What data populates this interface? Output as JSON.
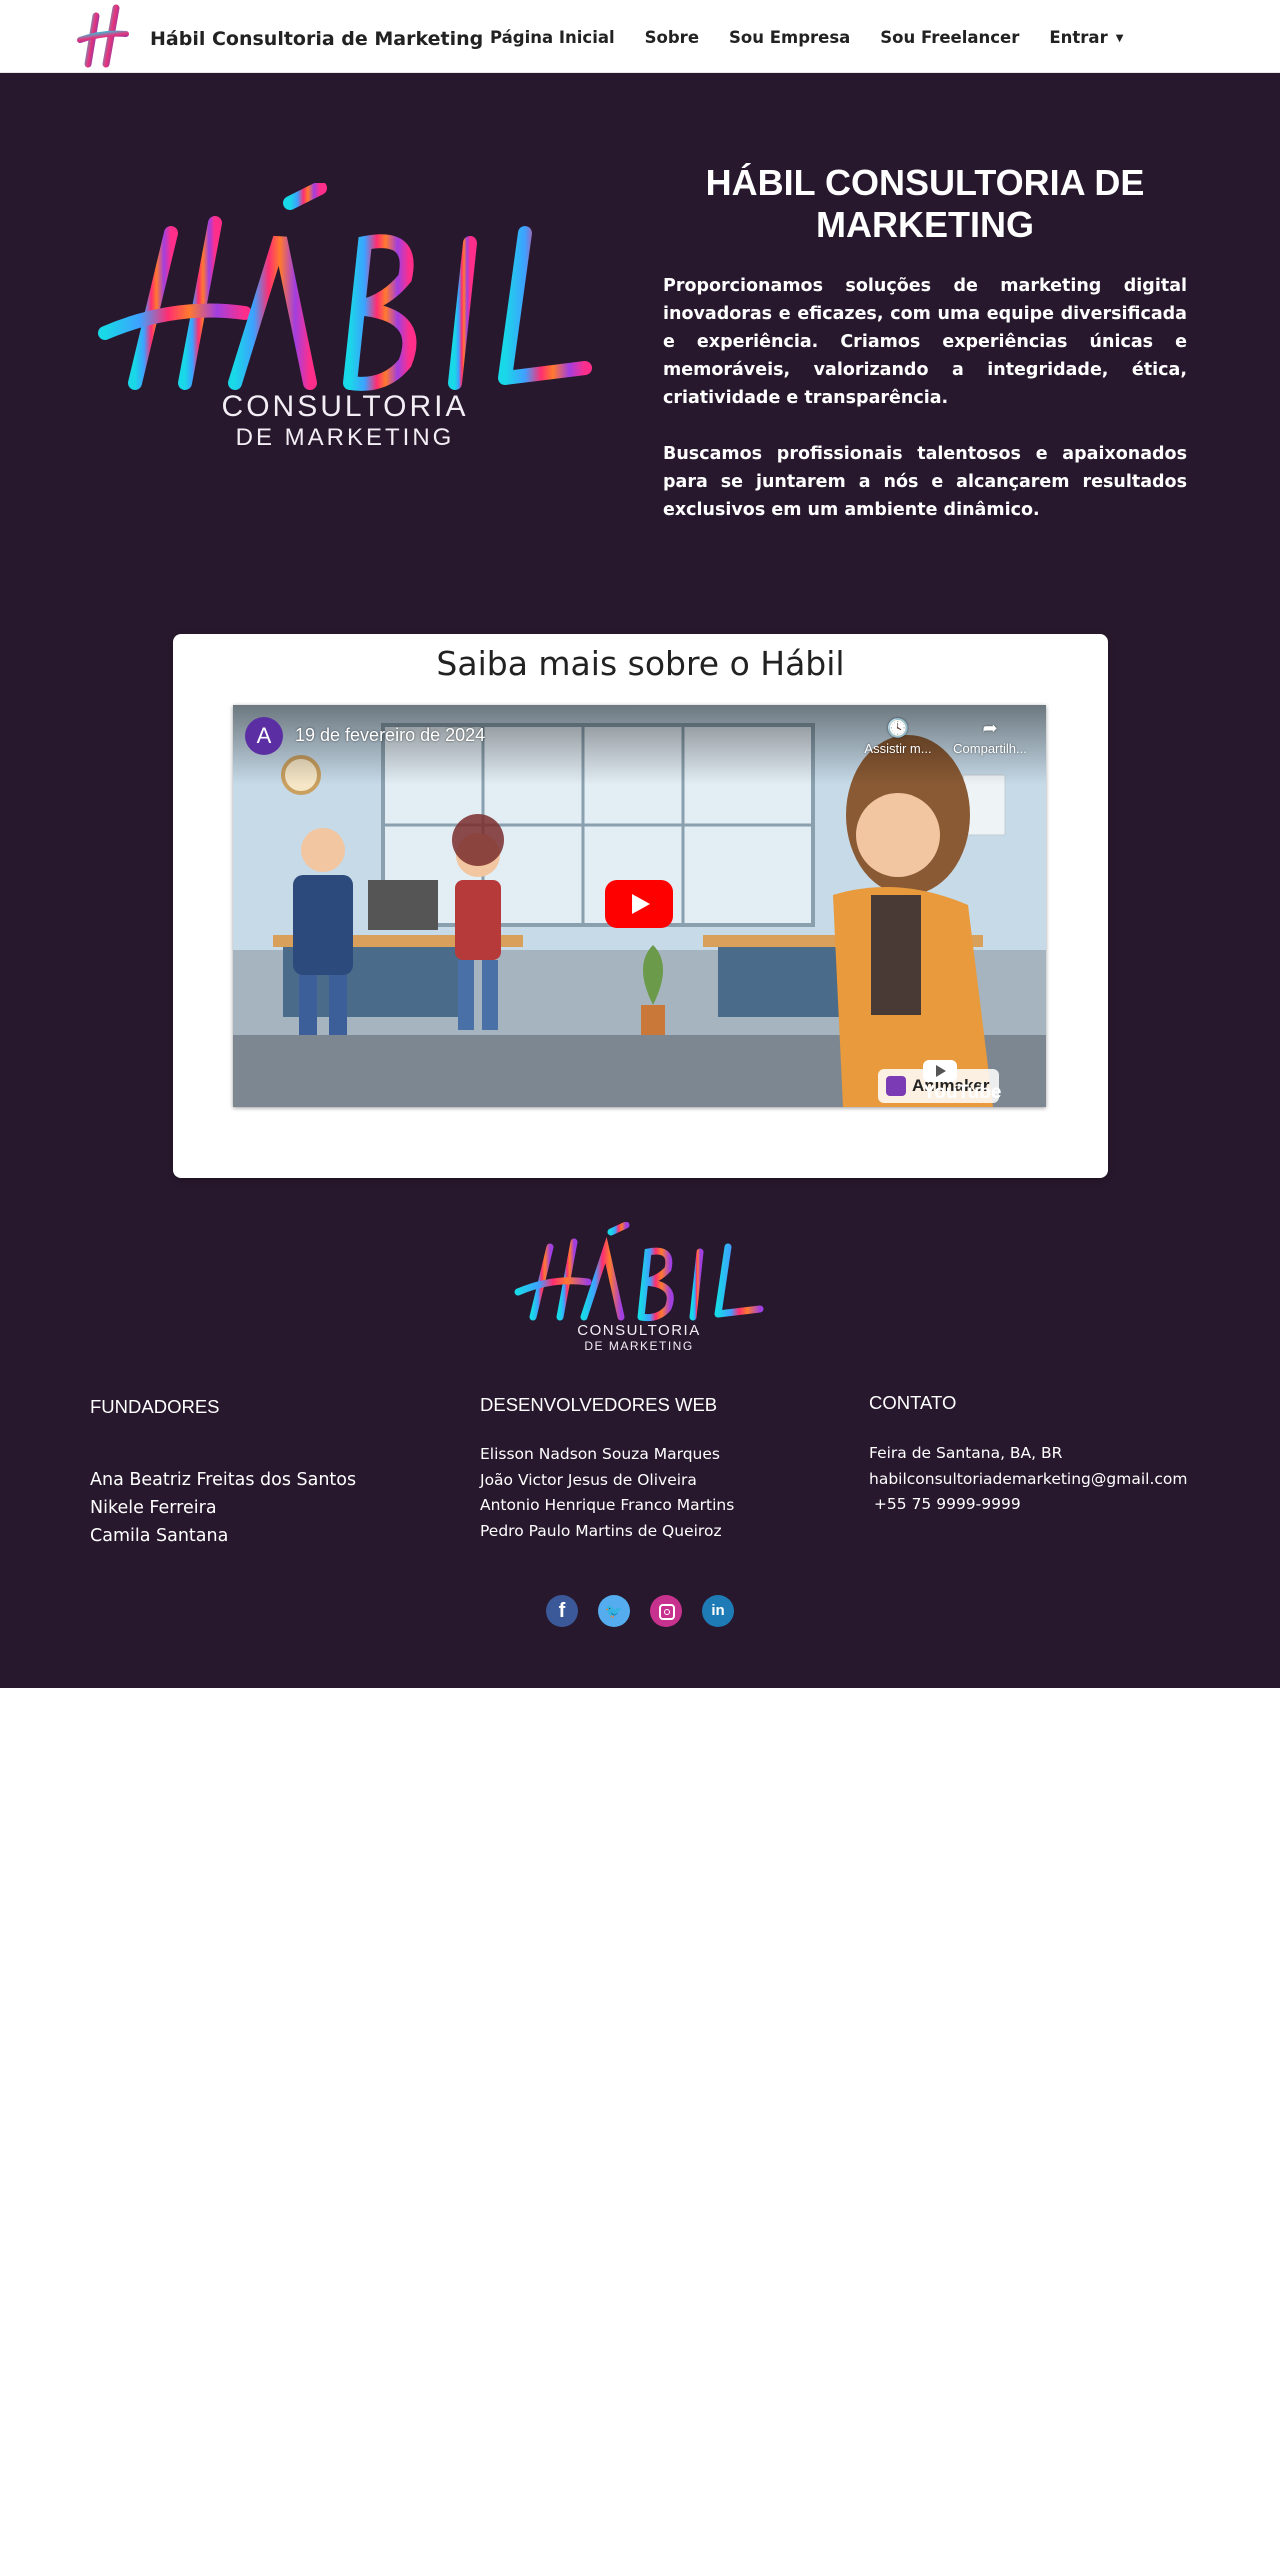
{
  "navbar": {
    "brand": "Hábil Consultoria de Marketing",
    "links": [
      "Página Inicial",
      "Sobre",
      "Sou Empresa",
      "Sou Freelancer",
      "Entrar"
    ]
  },
  "hero": {
    "logo_word": "HÁBIL",
    "logo_sub1": "CONSULTORIA",
    "logo_sub2": "DE MARKETING",
    "title": "HÁBIL CONSULTORIA DE MARKETING",
    "paragraph1": "Proporcionamos soluções de marketing digital inovadoras e eficazes, com uma equipe diversificada e experiência. Criamos experiências únicas e memoráveis, valorizando a integridade, ética, criatividade e transparência.",
    "paragraph2": "Buscamos profissionais talentosos e apaixonados para se juntarem a nós e alcançarem resultados exclusivos em um ambiente dinâmico."
  },
  "video": {
    "heading": "Saiba mais sobre o Hábil",
    "channel_initial": "A",
    "title": "19 de fevereiro de 2024",
    "watch_later": "Assistir m...",
    "share": "Compartilh...",
    "brand": "YouTube",
    "watermark": "Animaker"
  },
  "footer": {
    "logo_word": "HÁBIL",
    "logo_sub1": "CONSULTORIA",
    "logo_sub2": "DE MARKETING",
    "founders": {
      "heading": "FUNDADORES",
      "names": [
        "Ana Beatriz Freitas dos Santos",
        "Nikele Ferreira",
        "Camila Santana"
      ]
    },
    "developers": {
      "heading": "DESENVOLVEDORES WEB",
      "names": [
        "Elisson Nadson Souza Marques",
        "João Victor Jesus de Oliveira",
        "Antonio Henrique Franco Martins",
        "Pedro Paulo Martins de Queiroz"
      ]
    },
    "contact": {
      "heading": "CONTATO",
      "lines": [
        "Feira de Santana, BA, BR",
        "habilconsultoriademarketing@gmail.com",
        " +55 75 9999-9999"
      ]
    },
    "social": [
      {
        "icon": "facebook-icon",
        "glyph": "f"
      },
      {
        "icon": "twitter-icon",
        "glyph": "t"
      },
      {
        "icon": "instagram-icon",
        "glyph": ""
      },
      {
        "icon": "linkedin-icon",
        "glyph": "in"
      }
    ]
  },
  "colors": {
    "background_dark": "#28182d",
    "youtube_red": "#ff0000"
  }
}
